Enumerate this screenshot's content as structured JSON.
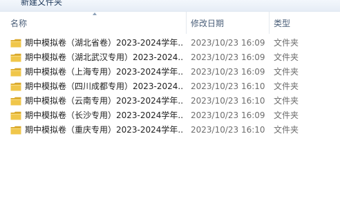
{
  "toolbar": {
    "new_folder_label": "新建文件夹"
  },
  "columns": {
    "name": "名称",
    "date": "修改日期",
    "type": "类型"
  },
  "files": [
    {
      "name": "期中模拟卷（湖北省卷）2023-2024学年...",
      "date": "2023/10/23 16:09",
      "type": "文件夹",
      "icon": "folder-icon"
    },
    {
      "name": "期中模拟卷（湖北武汉专用）2023-2024...",
      "date": "2023/10/23 16:09",
      "type": "文件夹",
      "icon": "folder-icon"
    },
    {
      "name": "期中模拟卷（上海专用）2023-2024学年...",
      "date": "2023/10/23 16:09",
      "type": "文件夹",
      "icon": "folder-icon"
    },
    {
      "name": "期中模拟卷（四川成都专用）2023-2024...",
      "date": "2023/10/23 16:10",
      "type": "文件夹",
      "icon": "folder-icon"
    },
    {
      "name": "期中模拟卷（云南专用）2023-2024学年...",
      "date": "2023/10/23 16:10",
      "type": "文件夹",
      "icon": "folder-icon"
    },
    {
      "name": "期中模拟卷（长沙专用）2023-2024学年...",
      "date": "2023/10/23 16:09",
      "type": "文件夹",
      "icon": "folder-icon"
    },
    {
      "name": "期中模拟卷（重庆专用）2023-2024学年...",
      "date": "2023/10/23 16:10",
      "type": "文件夹",
      "icon": "folder-icon"
    }
  ],
  "colors": {
    "folder_body": "#f0c64a",
    "folder_tab": "#d9a82b"
  }
}
